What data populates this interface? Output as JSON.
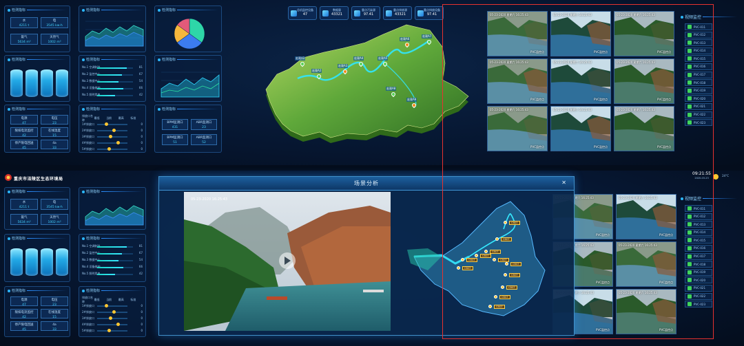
{
  "header": {
    "title": "重庆市涪陵区生态环境局",
    "time": "09:21:55",
    "date": "2020-03-23",
    "weather_temp": "24°C"
  },
  "panels": {
    "p1_title": "检测指标",
    "p1_items": [
      {
        "label": "水",
        "value": "4211 t"
      },
      {
        "label": "电",
        "value": "3545 kw·h"
      },
      {
        "label": "氨气",
        "value": "5634 m³"
      },
      {
        "label": "天然气",
        "value": "1002 m³"
      }
    ],
    "p2_title": "检测指标",
    "p2_cyl_count": 4,
    "p3_title": "检测指标",
    "p3_items": [
      {
        "label": "电源",
        "value": "47"
      },
      {
        "label": "电压",
        "value": "23"
      },
      {
        "label": "限排电流监控",
        "value": "42"
      },
      {
        "label": "在线温度",
        "value": "15"
      },
      {
        "label": "停产限电回送",
        "value": "45"
      },
      {
        "label": "4a",
        "value": "33"
      }
    ],
    "c1_title": "检测指标",
    "c2_title": "检测指标",
    "c2_rows": [
      {
        "label": "No.1 空调制冷",
        "pct": 0.82,
        "value": "81"
      },
      {
        "label": "No.2 监控中心",
        "pct": 0.7,
        "value": "67"
      },
      {
        "label": "No.3 数据中心",
        "pct": 0.6,
        "value": "54"
      },
      {
        "label": "No.4 设备维护",
        "pct": 0.74,
        "value": "66"
      },
      {
        "label": "No.5 照明用电",
        "pct": 0.5,
        "value": "42"
      }
    ],
    "c3_title": "检测指标",
    "c3_head": [
      "排放口名称",
      "最低",
      "当前",
      "最高",
      "标准"
    ],
    "c3_rows": [
      {
        "name": "1#排放口",
        "pos": 0.3,
        "std": "0"
      },
      {
        "name": "2#排放口",
        "pos": 0.55,
        "std": "0"
      },
      {
        "name": "3#排放口",
        "pos": 0.45,
        "std": "0"
      },
      {
        "name": "4#排放口",
        "pos": 0.7,
        "std": "0"
      },
      {
        "name": "5#排放口",
        "pos": 0.4,
        "std": "0"
      }
    ],
    "r1_title": "检测指标",
    "pie": [
      {
        "name": "A",
        "value": 35,
        "color": "#2ed6a8"
      },
      {
        "name": "B",
        "value": 30,
        "color": "#3c7cf0"
      },
      {
        "name": "C",
        "value": 20,
        "color": "#f6b73c"
      },
      {
        "name": "D",
        "value": 15,
        "color": "#e25a7a"
      }
    ],
    "r2_title": "检测指标",
    "r3_title": "检测指标",
    "r3_items": [
      {
        "label": "BPM监测口",
        "value": "431"
      },
      {
        "label": "ABR监测口",
        "value": "23"
      },
      {
        "label": "BPM监测口",
        "value": "51"
      },
      {
        "label": "ABR监测口",
        "value": "52"
      }
    ]
  },
  "top_stats": [
    {
      "label": "总机监控设备",
      "value": "47"
    },
    {
      "label": "数据量",
      "value": "43321"
    },
    {
      "label": "重点污染源",
      "value": "97.41"
    },
    {
      "label": "重点排放源",
      "value": "43321"
    },
    {
      "label": "重点排放设备",
      "value": "97.41"
    }
  ],
  "map_labels": [
    "宏观A1",
    "宏观A2",
    "宏观A3",
    "宏观A4",
    "宏观A5",
    "宏观A6",
    "宏观A7",
    "宏观A8",
    "宏观A9"
  ],
  "video_monitor": {
    "title": "视频监控",
    "items": [
      "PVC-011",
      "PVC-012",
      "PVC-013",
      "PVC-014",
      "PVC-015",
      "PVC-016",
      "PVC-017",
      "PVC-018",
      "PVC-019",
      "PVC-020",
      "PVC-021",
      "PVC-022",
      "PVC-023"
    ],
    "thumbs": [
      {
        "ts": "05-23-2020 星期六 16:25:43",
        "label": "PVC监控点"
      },
      {
        "ts": "05-23-2020 星期六 16:25:43",
        "label": "PVC监控点"
      },
      {
        "ts": "05-23-2020 星期六 16:25:43",
        "label": "PVC监控点"
      },
      {
        "ts": "05-23-2020 星期六 16:25:43",
        "label": "PVC监控点"
      },
      {
        "ts": "05-23-2020 星期六 16:25:43",
        "label": "PVC监控点"
      },
      {
        "ts": "05-23-2020 星期六 16:25:43",
        "label": "PVC监控点"
      },
      {
        "ts": "05-23-2020 星期六 16:25:43",
        "label": "PVC监控点"
      },
      {
        "ts": "05-23-2020 星期六 16:25:43",
        "label": "PVC监控点"
      },
      {
        "ts": "05-23-2020 星期六 16:25:43",
        "label": "PVC监控点"
      }
    ]
  },
  "modal": {
    "title": "场景分析",
    "video_ts": "05-23-2020 16:25:43",
    "map_tags": [
      "CBGT",
      "CBGT",
      "CBGT",
      "CBGT",
      "CBGT",
      "CBGT",
      "CBGT",
      "CBGT",
      "CBGT",
      "CBGT",
      "CBGT",
      "CBGT"
    ]
  },
  "colors": {
    "accent": "#2bb8ff",
    "alert": "#e8322f",
    "marker": "#ffc632",
    "green_tag": "#3fd45a"
  }
}
